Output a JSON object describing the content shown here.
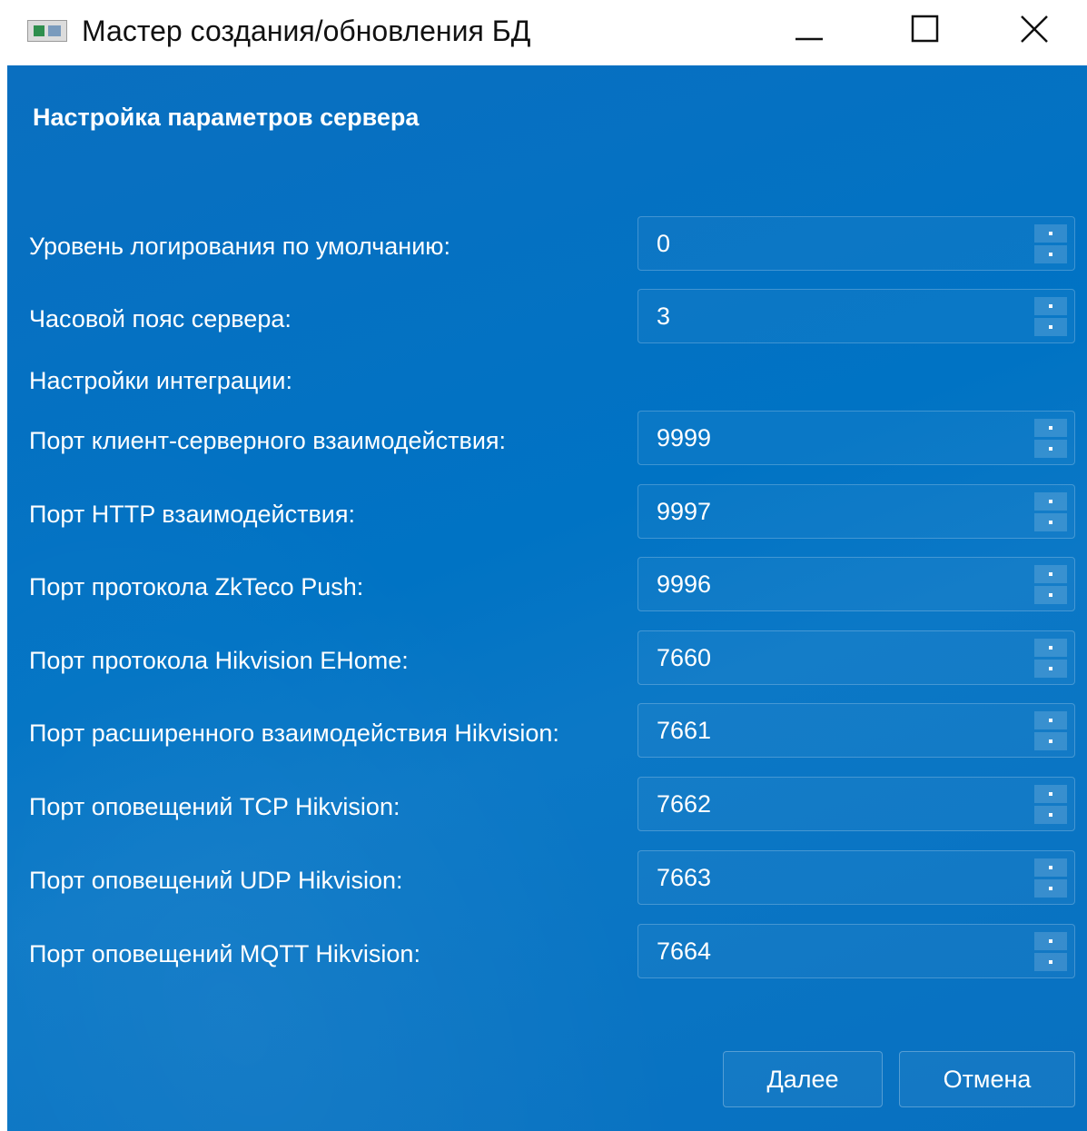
{
  "window": {
    "title": "Мастер создания/обновления БД"
  },
  "page": {
    "heading": "Настройка параметров сервера",
    "section_label": "Настройки интеграции:"
  },
  "fields": [
    {
      "label": "Уровень логирования по умолчанию:",
      "value": "0"
    },
    {
      "label": "Часовой пояс сервера:",
      "value": "3"
    },
    {
      "label": "Порт клиент-серверного взаимодействия:",
      "value": "9999"
    },
    {
      "label": "Порт HTTP взаимодействия:",
      "value": "9997"
    },
    {
      "label": "Порт протокола ZkTeco Push:",
      "value": "9996"
    },
    {
      "label": "Порт протокола Hikvision EHome:",
      "value": "7660"
    },
    {
      "label": "Порт расширенного взаимодействия Hikvision:",
      "value": "7661"
    },
    {
      "label": "Порт оповещений TCP Hikvision:",
      "value": "7662"
    },
    {
      "label": "Порт оповещений UDP Hikvision:",
      "value": "7663"
    },
    {
      "label": "Порт оповещений MQTT Hikvision:",
      "value": "7664"
    }
  ],
  "buttons": {
    "next": "Далее",
    "cancel": "Отмена"
  }
}
